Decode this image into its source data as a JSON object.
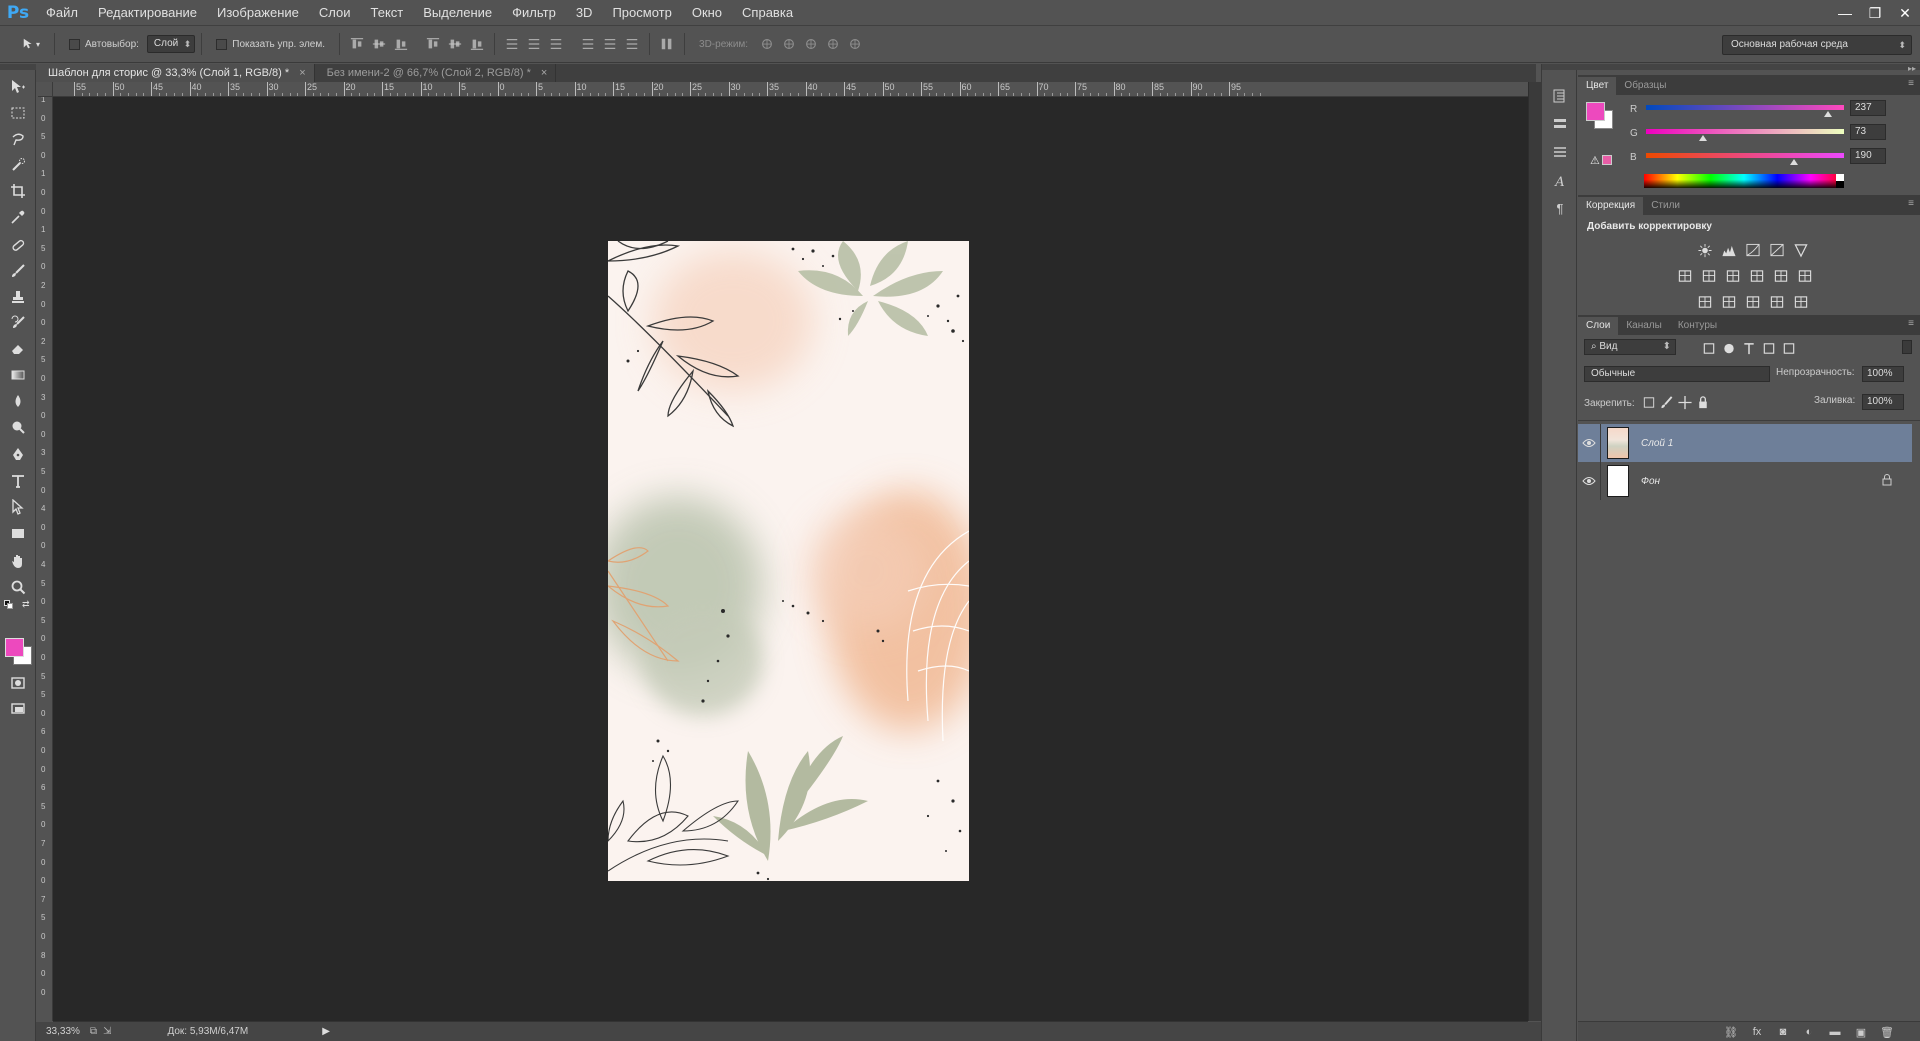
{
  "app": {
    "logo": "Ps"
  },
  "menu": [
    "Файл",
    "Редактирование",
    "Изображение",
    "Слои",
    "Текст",
    "Выделение",
    "Фильтр",
    "3D",
    "Просмотр",
    "Окно",
    "Справка"
  ],
  "window_controls": {
    "minimize": "—",
    "restore": "❐",
    "close": "✕"
  },
  "options_bar": {
    "autoselect_label": "Автовыбор:",
    "autoselect_target": "Слой",
    "show_transform_label": "Показать упр. элем.",
    "mode3d_label": "3D-режим:",
    "workspace": "Основная рабочая среда"
  },
  "tabs": [
    {
      "label": "Шаблон для сторис @ 33,3% (Слой 1, RGB/8) *",
      "active": true
    },
    {
      "label": "Без имени-2 @ 66,7% (Слой 2, RGB/8) *",
      "active": false
    }
  ],
  "ruler_h_labels": [
    "55",
    "50",
    "45",
    "40",
    "35",
    "30",
    "25",
    "20",
    "15",
    "10",
    "5",
    "0",
    "5",
    "10",
    "15",
    "20",
    "25",
    "30",
    "35",
    "40",
    "45",
    "50",
    "55",
    "60",
    "65",
    "70",
    "75",
    "80",
    "85",
    "90",
    "95"
  ],
  "ruler_v_labels": [
    "1",
    "0",
    "5",
    "0",
    "1",
    "0",
    "0",
    "1",
    "5",
    "0",
    "2",
    "0",
    "0",
    "2",
    "5",
    "0",
    "3",
    "0",
    "0",
    "3",
    "5",
    "0",
    "4",
    "0",
    "0",
    "4",
    "5",
    "0",
    "5",
    "0",
    "0",
    "5",
    "5",
    "0",
    "6",
    "0",
    "0",
    "6",
    "5",
    "0",
    "7",
    "0",
    "0",
    "7",
    "5",
    "0",
    "8",
    "0",
    "0"
  ],
  "status": {
    "zoom": "33,33%",
    "doc": "Док: 5,93M/6,47M"
  },
  "color_panel": {
    "tabs": [
      "Цвет",
      "Образцы"
    ],
    "fg_color": "#ed49be",
    "bg_color": "#ffffff",
    "channels": [
      {
        "label": "R",
        "value": "237"
      },
      {
        "label": "G",
        "value": "73"
      },
      {
        "label": "B",
        "value": "190"
      }
    ]
  },
  "adjust_panel": {
    "tabs": [
      "Коррекция",
      "Стили"
    ],
    "title": "Добавить корректировку"
  },
  "layers_panel": {
    "tabs": [
      "Слои",
      "Каналы",
      "Контуры"
    ],
    "filter": "Вид",
    "blend_mode": "Обычные",
    "opacity_label": "Непрозрачность:",
    "opacity": "100%",
    "lock_label": "Закрепить:",
    "fill_label": "Заливка:",
    "fill": "100%",
    "layers": [
      {
        "name": "Слой 1",
        "selected": true
      },
      {
        "name": "Фон",
        "selected": false
      }
    ]
  }
}
